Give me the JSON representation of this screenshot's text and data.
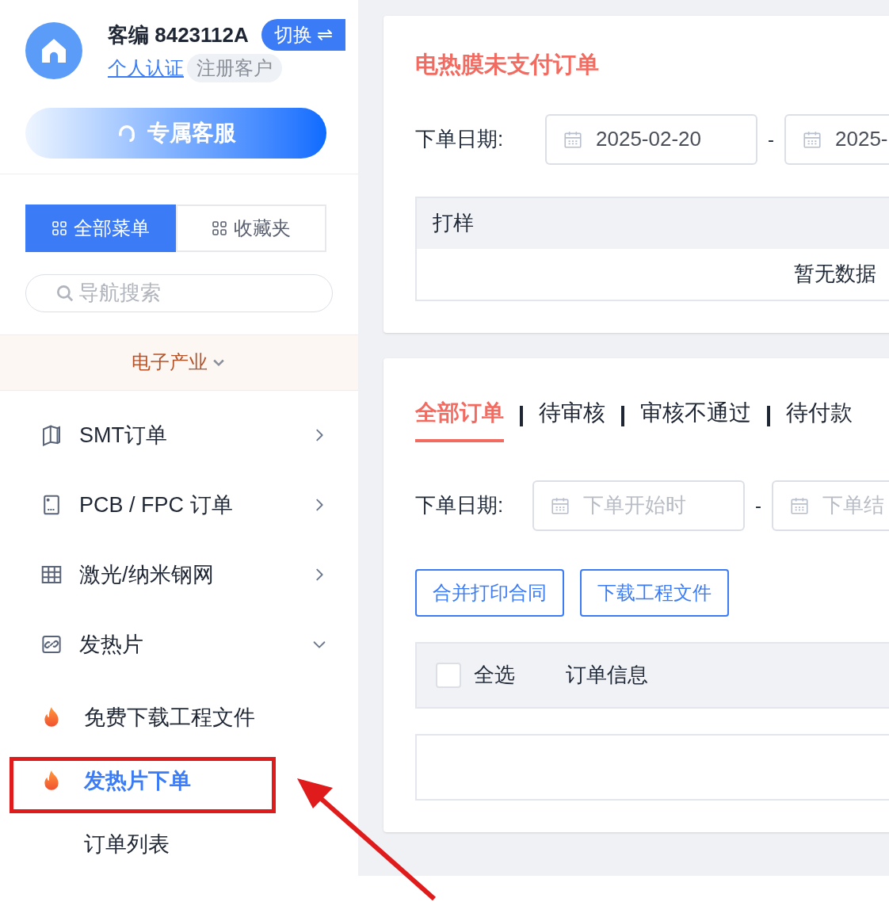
{
  "user": {
    "id_label": "客编 8423112A",
    "switch_button": "切换 ⇌",
    "verify_link": "个人认证",
    "customer_type": "注册客户"
  },
  "service_button": "专属客服",
  "menu_tabs": [
    {
      "label": "全部菜单",
      "selected": true
    },
    {
      "label": "收藏夹",
      "selected": false
    }
  ],
  "nav_search": {
    "placeholder": "导航搜索"
  },
  "industry": {
    "label": "电子产业"
  },
  "nav": [
    {
      "label": "SMT订单",
      "expanded": false
    },
    {
      "label": "PCB / FPC 订单",
      "expanded": false
    },
    {
      "label": "激光/纳米钢网",
      "expanded": false
    },
    {
      "label": "发热片",
      "expanded": true,
      "children": [
        {
          "label": "免费下载工程文件",
          "hot": true,
          "selected": false
        },
        {
          "label": "发热片下单",
          "hot": true,
          "selected": true
        },
        {
          "label": "订单列表",
          "hot": false,
          "selected": false
        }
      ]
    }
  ],
  "unpaid_card": {
    "title": "电热膜未支付订单",
    "date_label": "下单日期:",
    "date_from": "2025-02-20",
    "date_separator": "-",
    "date_to": "2025-",
    "table": {
      "columns": [
        "打样"
      ],
      "empty_text": "暂无数据"
    }
  },
  "orders_card": {
    "tabs": [
      {
        "label": "全部订单",
        "selected": true
      },
      {
        "label": "待审核",
        "selected": false
      },
      {
        "label": "审核不通过",
        "selected": false
      },
      {
        "label": "待付款",
        "selected": false
      }
    ],
    "date_label": "下单日期:",
    "date_from": {
      "placeholder": "下单开始时"
    },
    "date_separator": "-",
    "date_to": {
      "placeholder": "下单结"
    },
    "actions": [
      "合并打印合同",
      "下载工程文件"
    ],
    "table": {
      "select_all": {
        "label": "全选",
        "checked": false
      },
      "columns": [
        "订单信息"
      ]
    }
  }
}
